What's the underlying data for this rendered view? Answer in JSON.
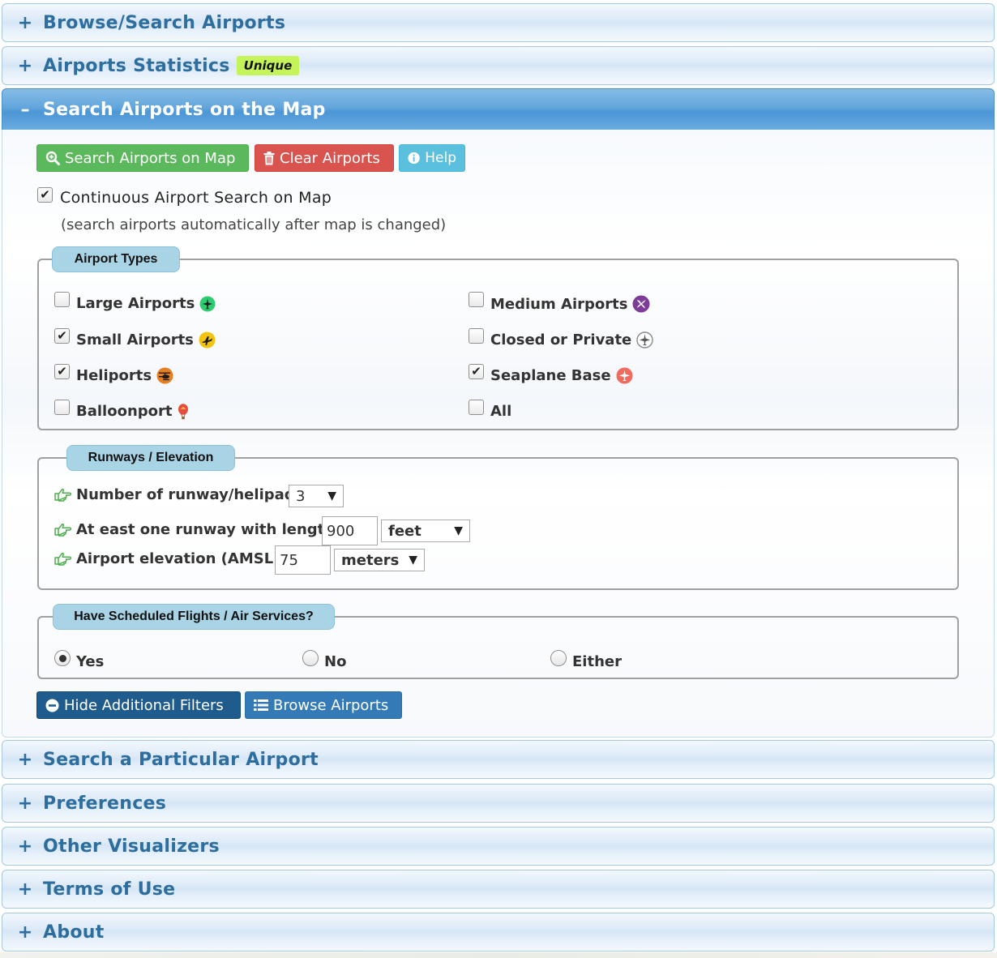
{
  "accordion": {
    "browse": "Browse/Search Airports",
    "statistics": "Airports Statistics",
    "statistics_badge": "Unique",
    "search_map": "Search Airports on the Map",
    "particular": "Search a Particular Airport",
    "preferences": "Preferences",
    "visualizers": "Other Visualizers",
    "terms": "Terms of Use",
    "about": "About",
    "sign_collapsed": "+",
    "sign_expanded": "–"
  },
  "toolbar": {
    "search_label": "Search Airports on Map",
    "clear_label": "Clear Airports",
    "help_label": "Help"
  },
  "continuous": {
    "label": "Continuous Airport Search on Map",
    "note": "(search airports automatically after map is changed)",
    "checked": true
  },
  "airport_types": {
    "legend": "Airport Types",
    "items": [
      {
        "label": "Large Airports",
        "checked": false,
        "icon": "large-airport-icon",
        "color": "#2ecc71"
      },
      {
        "label": "Medium Airports",
        "checked": false,
        "icon": "medium-airport-icon",
        "color": "#7d3c98"
      },
      {
        "label": "Small Airports",
        "checked": true,
        "icon": "small-airport-icon",
        "color": "#f1c40f"
      },
      {
        "label": "Closed or Private",
        "checked": false,
        "icon": "closed-airport-icon",
        "color": "#8a8a8a"
      },
      {
        "label": "Heliports",
        "checked": true,
        "icon": "heliport-icon",
        "color": "#e67e22"
      },
      {
        "label": "Seaplane Base",
        "checked": true,
        "icon": "seaplane-icon",
        "color": "#f06a5e"
      },
      {
        "label": "Balloonport",
        "checked": false,
        "icon": "balloon-icon",
        "color": "#e74c3c"
      },
      {
        "label": "All",
        "checked": false,
        "icon": "",
        "color": ""
      }
    ]
  },
  "runways": {
    "legend": "Runways / Elevation",
    "count_label": "Number of runway/helipad ≥",
    "count_value": "3",
    "length_label": "At east one runway with length ≥",
    "length_value": "900",
    "length_unit": "feet",
    "elevation_label": "Airport elevation (AMSL) ≥",
    "elevation_value": "75",
    "elevation_unit": "meters"
  },
  "scheduled": {
    "legend": "Have Scheduled Flights / Air Services?",
    "options": [
      {
        "label": "Yes",
        "selected": true
      },
      {
        "label": "No",
        "selected": false
      },
      {
        "label": "Either",
        "selected": false
      }
    ]
  },
  "bottom_buttons": {
    "hide_filters": "Hide Additional Filters",
    "browse": "Browse Airports"
  },
  "colors": {
    "header_text": "#2e6e9e",
    "active_header": "#4c96d6",
    "green": "#5cb85c",
    "red": "#d9534f",
    "cyan": "#5bc0de",
    "navy": "#1f5b8c",
    "blue": "#337ab7",
    "legend_bg": "#a8d4e6",
    "badge": "#c4f35a",
    "hand_icon": "#4cae4c"
  }
}
